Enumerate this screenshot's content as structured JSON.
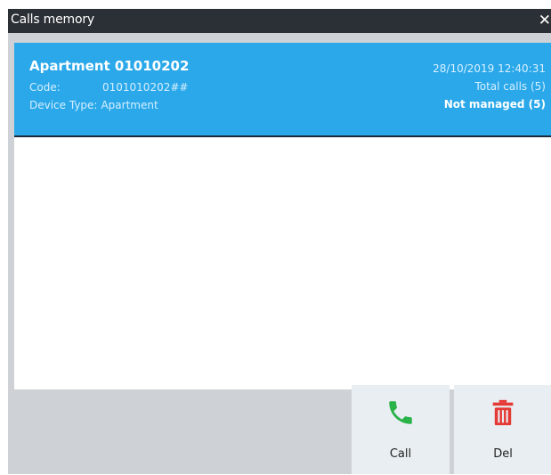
{
  "window": {
    "title": "Calls memory",
    "close_glyph": "✕"
  },
  "calls": [
    {
      "title": "Apartment 01010202",
      "code_label": "Code:",
      "code_value": "0101010202##",
      "device_type_label": "Device Type:",
      "device_type_value": "Apartment",
      "datetime": "28/10/2019 12:40:31",
      "total_calls": "Total calls (5)",
      "status": "Not managed (5)"
    }
  ],
  "actions": {
    "call_label": "Call",
    "call_icon": "phone-icon",
    "call_color": "#2bb34a",
    "del_label": "Del",
    "del_icon": "trash-icon",
    "del_color": "#e53935"
  },
  "colors": {
    "titlebar": "#2b3036",
    "background": "#ced2d6",
    "selected_item": "#2aa8ea",
    "button": "#e9eef2"
  }
}
